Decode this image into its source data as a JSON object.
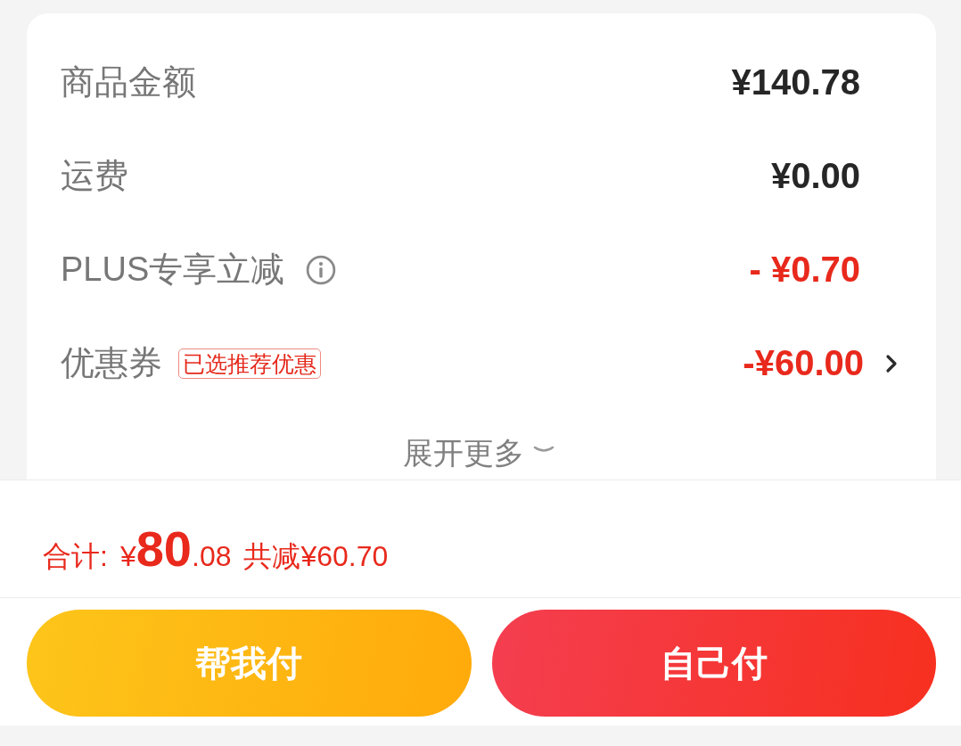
{
  "summary": {
    "rows": [
      {
        "kind": "amount",
        "label": "商品金额",
        "value": "¥140.78",
        "discount": false
      },
      {
        "kind": "amount",
        "label": "运费",
        "value": "¥0.00",
        "discount": false
      },
      {
        "kind": "info",
        "label": "PLUS专享立减",
        "value": "- ¥0.70",
        "discount": true
      },
      {
        "kind": "coupon",
        "label": "优惠券",
        "tag": "已选推荐优惠",
        "value": "-¥60.00",
        "discount": true
      }
    ],
    "expand": {
      "label": "展开更多",
      "expanded": false
    }
  },
  "total": {
    "label": "合计:",
    "price": "¥**80**.08",
    "savings": "共减¥60.70"
  },
  "buttons": [
    {
      "kind": "secondary",
      "label": "帮我付"
    },
    {
      "kind": "primary",
      "label": "自己付"
    }
  ]
}
